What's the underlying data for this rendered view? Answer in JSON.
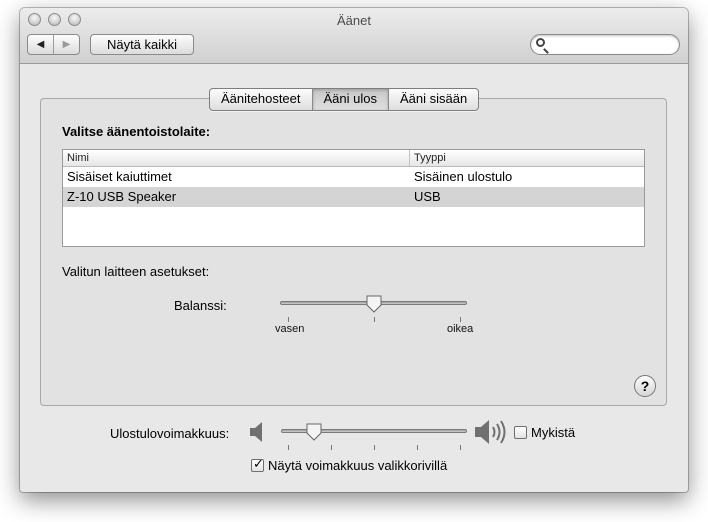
{
  "window": {
    "title": "Äänet"
  },
  "toolbar": {
    "back_icon": "triangle-left-icon",
    "forward_icon": "triangle-right-icon",
    "show_all_label": "Näytä kaikki",
    "search_value": ""
  },
  "tabs": [
    {
      "label": "Äänitehosteet",
      "active": false
    },
    {
      "label": "Ääni ulos",
      "active": true
    },
    {
      "label": "Ääni sisään",
      "active": false
    }
  ],
  "output": {
    "heading": "Valitse äänentoistolaite:",
    "columns": [
      "Nimi",
      "Tyyppi"
    ],
    "devices": [
      {
        "name": "Sisäiset kaiuttimet",
        "type": "Sisäinen ulostulo",
        "selected": false
      },
      {
        "name": "Z-10 USB Speaker",
        "type": "USB",
        "selected": true
      }
    ],
    "settings_label": "Valitun laitteen asetukset:",
    "balance_label": "Balanssi:",
    "balance_left": "vasen",
    "balance_right": "oikea",
    "balance_value": 0.5
  },
  "volume": {
    "label": "Ulostulovoimakkuus:",
    "value": 0.15,
    "mute_label": "Mykistä",
    "mute_checked": false,
    "show_in_menu_label": "Näytä voimakkuus valikkorivillä",
    "show_in_menu_checked": true
  },
  "help_label": "?",
  "colors": {
    "selected_row": "#d4d4d4",
    "window_bg": "#e8e8e8"
  }
}
